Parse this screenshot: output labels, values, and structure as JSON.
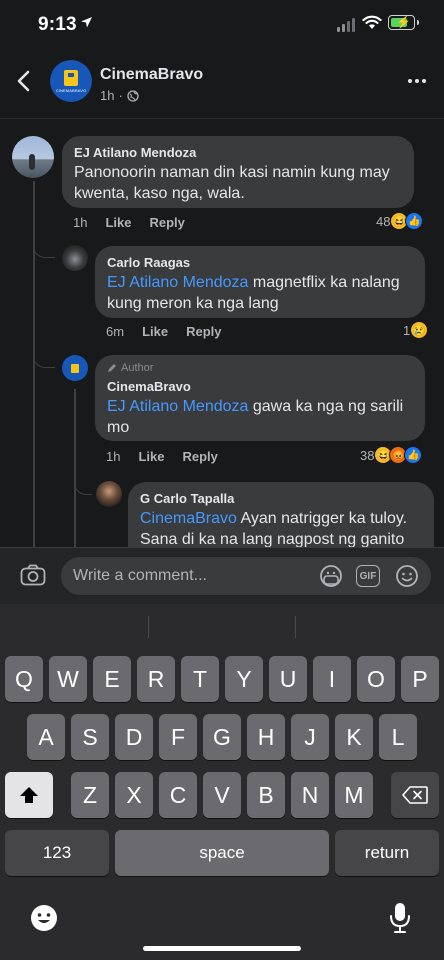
{
  "status_bar": {
    "time": "9:13"
  },
  "header": {
    "page_name": "CinemaBravo",
    "post_time": "1h",
    "logo_text": "CINEMABRAVO"
  },
  "comments": [
    {
      "author": "EJ Atilano Mendoza",
      "text_lines": [
        "Panonoorin naman din kasi namin kung may",
        "kwenta, kaso nga, wala."
      ],
      "time": "1h",
      "like_label": "Like",
      "reply_label": "Reply",
      "reaction_count": "48"
    },
    {
      "author": "Carlo Raagas",
      "mention": "EJ Atilano Mendoza",
      "text_line1": " magnetflix ka nalang",
      "text_line2": "kung meron ka nga lang",
      "time": "6m",
      "like_label": "Like",
      "reply_label": "Reply",
      "reaction_count": "1"
    },
    {
      "badge": "Author",
      "author": "CinemaBravo",
      "mention": "EJ Atilano Mendoza",
      "text_line1": " gawa ka nga ng sarili",
      "text_line2": "mo",
      "time": "1h",
      "like_label": "Like",
      "reply_label": "Reply",
      "reaction_count": "38"
    },
    {
      "author": "G Carlo Tapalla",
      "mention": "CinemaBravo",
      "text_line1": " Ayan natrigger ka tuloy.",
      "text_line2": "Sana di ka na lang nagpost ng ganito"
    }
  ],
  "composer": {
    "placeholder": "Write a comment...",
    "gif_label": "GIF"
  },
  "keyboard": {
    "row1": [
      "Q",
      "W",
      "E",
      "R",
      "T",
      "Y",
      "U",
      "I",
      "O",
      "P"
    ],
    "row2": [
      "A",
      "S",
      "D",
      "F",
      "G",
      "H",
      "J",
      "K",
      "L"
    ],
    "row3": [
      "Z",
      "X",
      "C",
      "V",
      "B",
      "N",
      "M"
    ],
    "numbers_label": "123",
    "space_label": "space",
    "return_label": "return"
  },
  "colors": {
    "background": "#18191a",
    "bubble": "#3a3b3c",
    "mention": "#4599ff",
    "page_blue": "#1657b8"
  }
}
